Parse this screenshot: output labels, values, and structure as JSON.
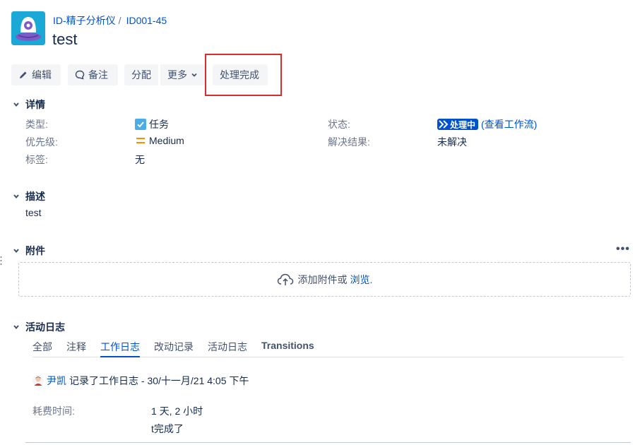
{
  "header": {
    "breadcrumb_project": "ID-精子分析仪",
    "breadcrumb_sep": "/",
    "breadcrumb_issue": "ID001-45",
    "title": "test",
    "project_avatar_icon": "alien-robot-avatar-icon"
  },
  "toolbar": {
    "edit_label": "编辑",
    "comment_label": "备注",
    "assign_label": "分配",
    "more_label": "更多",
    "resolve_label": "处理完成"
  },
  "details": {
    "heading": "详情",
    "type_label": "类型:",
    "type_value": "任务",
    "priority_label": "优先级:",
    "priority_value": "Medium",
    "labels_label": "标签:",
    "labels_value": "无",
    "status_label": "状态:",
    "status_value": "处理中",
    "workflow_link": "(查看工作流)",
    "resolution_label": "解决结果:",
    "resolution_value": "未解决"
  },
  "description": {
    "heading": "描述",
    "text": "test"
  },
  "attachments": {
    "heading": "附件",
    "more": "•••",
    "drop_text": "添加附件或",
    "browse_link": "浏览."
  },
  "activity": {
    "heading": "活动日志",
    "tabs": [
      "全部",
      "注释",
      "工作日志",
      "改动记录",
      "活动日志",
      "Transitions"
    ],
    "active_tab": "工作日志",
    "entry": {
      "user": "尹凯",
      "action": "记录了工作日志 - 30/十一月/21 4:05 下午",
      "time_spent_label": "耗费时间:",
      "time_spent_value": "1 天, 2 小时",
      "comment": "t完成了"
    }
  },
  "colors": {
    "link": "#0052cc",
    "status": "#0052cc",
    "highlight": "#d92c2c",
    "priority": "#ff8b00",
    "task_icon": "#4bade8"
  }
}
